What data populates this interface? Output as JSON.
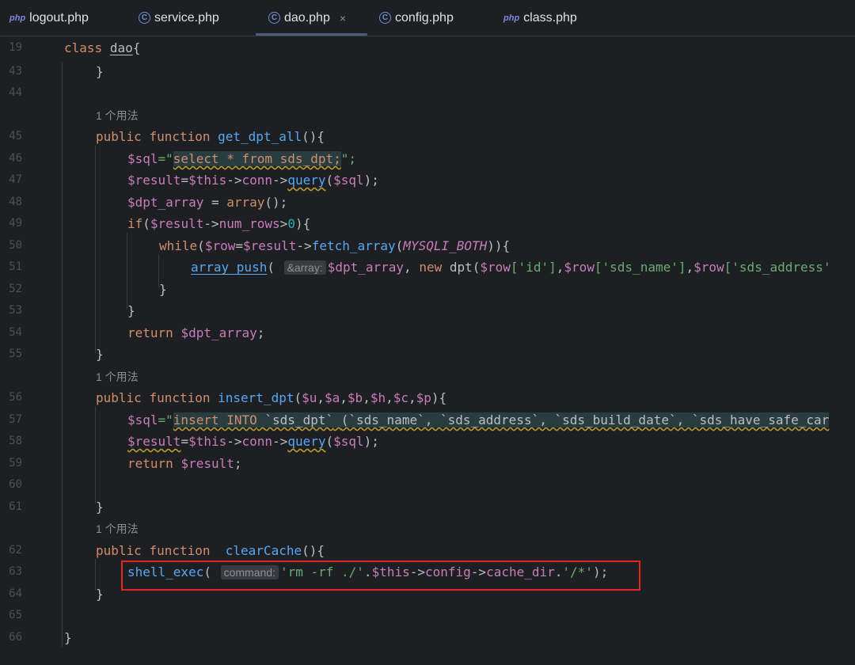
{
  "tabs": [
    {
      "id": "logout",
      "label": "logout.php",
      "icon": "php-file-icon"
    },
    {
      "id": "service",
      "label": "service.php",
      "icon": "class-file-icon"
    },
    {
      "id": "dao",
      "label": "dao.php",
      "icon": "class-file-icon",
      "active": true,
      "close": "×"
    },
    {
      "id": "config",
      "label": "config.php",
      "icon": "class-file-icon"
    },
    {
      "id": "class",
      "label": "class.php",
      "icon": "php-file-icon"
    }
  ],
  "icons": {
    "php_badge": "php",
    "class_badge": "C"
  },
  "line_numbers": [
    "19",
    "43",
    "44",
    "45",
    "46",
    "47",
    "48",
    "49",
    "50",
    "51",
    "52",
    "53",
    "54",
    "55",
    "56",
    "57",
    "58",
    "59",
    "60",
    "61",
    "62",
    "63",
    "64",
    "65",
    "66"
  ],
  "usage_hint": "1 个用法",
  "inlay_hints": {
    "array_param": "&array:",
    "command_param": "command:"
  },
  "colors": {
    "background": "#1e1f22",
    "keyword": "#cf8e6d",
    "function": "#56a8f5",
    "variable": "#c77dbb",
    "string": "#6aab73",
    "highlight": "#e0271f"
  },
  "code": {
    "l19": [
      "class",
      "dao",
      "{"
    ],
    "l43": "}",
    "l45": [
      "public",
      "function",
      "get_dpt_all",
      "(){"
    ],
    "l46": [
      "$sql",
      "=\"",
      "select * from sds_dpt;",
      "\";"
    ],
    "l47": [
      "$result",
      "=",
      "$this",
      "->",
      "conn",
      "->",
      "query",
      "(",
      "$sql",
      ");"
    ],
    "l48": [
      "$dpt_array",
      " = ",
      "array",
      "();"
    ],
    "l49": [
      "if",
      "(",
      "$result",
      "->",
      "num_rows",
      ">",
      "0",
      "){"
    ],
    "l50": [
      "while",
      "(",
      "$row",
      "=",
      "$result",
      "->",
      "fetch_array",
      "(",
      "MYSQLI_BOTH",
      "))",
      "{"
    ],
    "l51": [
      "array_push",
      "( ",
      "$dpt_array",
      ", ",
      "new",
      " dpt(",
      "$row",
      "['id']",
      ",",
      "$row",
      "['sds_name']",
      ",",
      "$row",
      "['sds_address'"
    ],
    "l52": "}",
    "l53": "}",
    "l54": [
      "return",
      "$dpt_array",
      ";"
    ],
    "l55": "}",
    "l56": [
      "public",
      "function",
      "insert_dpt",
      "(",
      "$u",
      ",",
      "$a",
      ",",
      "$b",
      ",",
      "$h",
      ",",
      "$c",
      ",",
      "$p",
      "){"
    ],
    "l57": [
      "$sql",
      "=\"",
      "insert INTO",
      "`sds_dpt`",
      "(`sds_name`, `sds_address`, `sds_build_date`, `sds_have_safe_car"
    ],
    "l58": [
      "$result",
      "=",
      "$this",
      "->",
      "conn",
      "->",
      "query",
      "(",
      "$sql",
      ");"
    ],
    "l59": [
      "return",
      "$result",
      ";"
    ],
    "l61": "}",
    "l62": [
      "public",
      "function",
      "clearCache",
      "(){"
    ],
    "l63": [
      "shell_exec",
      "( ",
      "'rm -rf ./'",
      ".",
      "$this",
      "->",
      "config",
      "->",
      "cache_dir",
      ".",
      "'/*'",
      ");"
    ],
    "l64": "}",
    "l66": "}"
  }
}
